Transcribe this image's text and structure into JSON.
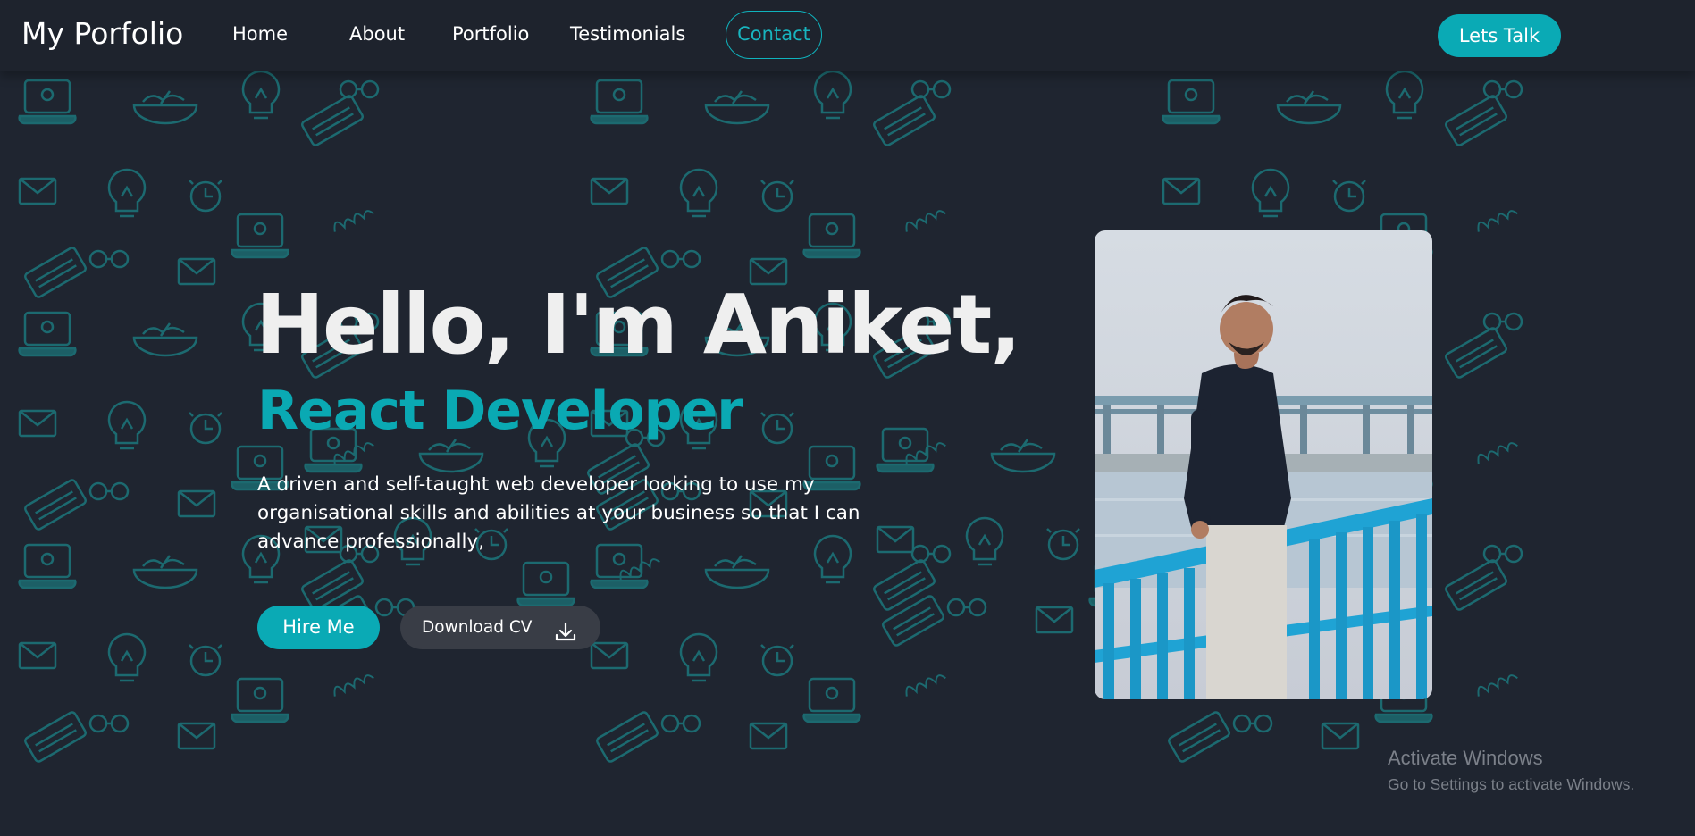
{
  "nav": {
    "brand": "My Porfolio",
    "links": [
      "Home",
      "About",
      "Portfolio",
      "Testimonials"
    ],
    "contact": "Contact",
    "cta": "Lets Talk"
  },
  "hero": {
    "title": "Hello, I'm Aniket,",
    "subtitle": "React Developer",
    "description": "A driven and self-taught web developer looking to use my organisational skills and abilities at your business so that I can advance professionally,",
    "hire_button": "Hire Me",
    "cv_button": "Download CV",
    "cv_icon": "download-icon",
    "photo": "profile-photo"
  },
  "watermark": {
    "title": "Activate Windows",
    "subtitle": "Go to Settings to activate Windows."
  },
  "colors": {
    "background": "#1f2530",
    "navbar": "#1e232d",
    "accent": "#0aaab5",
    "doodle": "#1c6a70",
    "secondary_button": "#393d46"
  }
}
